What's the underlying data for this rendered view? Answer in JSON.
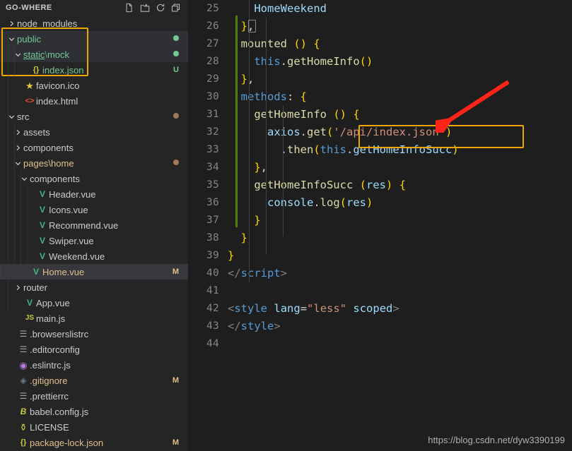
{
  "sidebar": {
    "title": "GO-WHERE",
    "actions": [
      {
        "name": "new-file-icon",
        "tooltip": "New File"
      },
      {
        "name": "new-folder-icon",
        "tooltip": "New Folder"
      },
      {
        "name": "refresh-icon",
        "tooltip": "Refresh Explorer"
      },
      {
        "name": "collapse-all-icon",
        "tooltip": "Collapse Folders in Explorer"
      }
    ],
    "tree": [
      {
        "label": "node_modules",
        "kind": "folder",
        "depth": 0,
        "expanded": false,
        "icon": "chevron-right-icon",
        "badge": "",
        "dot": "",
        "color": "white",
        "state": ""
      },
      {
        "label": "public",
        "kind": "folder",
        "depth": 0,
        "expanded": true,
        "icon": "chevron-down-icon",
        "badge": "",
        "dot": "green",
        "color": "green",
        "state": "sel-bg"
      },
      {
        "label": "static\\mock",
        "kind": "folder",
        "depth": 1,
        "expanded": true,
        "icon": "chevron-down-icon",
        "badge": "",
        "dot": "green",
        "color": "green",
        "state": "sel-bg",
        "underline": "static"
      },
      {
        "label": "index.json",
        "kind": "json",
        "depth": 2,
        "expanded": null,
        "icon": "json-file-icon",
        "badge": "U",
        "badgeClass": "u",
        "dot": "",
        "color": "green",
        "state": ""
      },
      {
        "label": "favicon.ico",
        "kind": "ico",
        "depth": 1,
        "expanded": null,
        "icon": "star-icon",
        "badge": "",
        "dot": "",
        "color": "white",
        "state": ""
      },
      {
        "label": "index.html",
        "kind": "html",
        "depth": 1,
        "expanded": null,
        "icon": "html-file-icon",
        "badge": "",
        "dot": "",
        "color": "white",
        "state": ""
      },
      {
        "label": "src",
        "kind": "folder",
        "depth": 0,
        "expanded": true,
        "icon": "chevron-down-icon",
        "badge": "",
        "dot": "amber",
        "color": "white",
        "state": ""
      },
      {
        "label": "assets",
        "kind": "folder",
        "depth": 1,
        "expanded": false,
        "icon": "chevron-right-icon",
        "badge": "",
        "dot": "",
        "color": "white",
        "state": ""
      },
      {
        "label": "components",
        "kind": "folder",
        "depth": 1,
        "expanded": false,
        "icon": "chevron-right-icon",
        "badge": "",
        "dot": "",
        "color": "white",
        "state": ""
      },
      {
        "label": "pages\\home",
        "kind": "folder",
        "depth": 1,
        "expanded": true,
        "icon": "chevron-down-icon",
        "badge": "",
        "dot": "amber",
        "color": "amber",
        "state": ""
      },
      {
        "label": "components",
        "kind": "folder",
        "depth": 2,
        "expanded": true,
        "icon": "chevron-down-icon",
        "badge": "",
        "dot": "",
        "color": "white",
        "state": ""
      },
      {
        "label": "Header.vue",
        "kind": "vue",
        "depth": 3,
        "expanded": null,
        "icon": "vue-file-icon",
        "badge": "",
        "dot": "",
        "color": "white",
        "state": ""
      },
      {
        "label": "Icons.vue",
        "kind": "vue",
        "depth": 3,
        "expanded": null,
        "icon": "vue-file-icon",
        "badge": "",
        "dot": "",
        "color": "white",
        "state": ""
      },
      {
        "label": "Recommend.vue",
        "kind": "vue",
        "depth": 3,
        "expanded": null,
        "icon": "vue-file-icon",
        "badge": "",
        "dot": "",
        "color": "white",
        "state": ""
      },
      {
        "label": "Swiper.vue",
        "kind": "vue",
        "depth": 3,
        "expanded": null,
        "icon": "vue-file-icon",
        "badge": "",
        "dot": "",
        "color": "white",
        "state": ""
      },
      {
        "label": "Weekend.vue",
        "kind": "vue",
        "depth": 3,
        "expanded": null,
        "icon": "vue-file-icon",
        "badge": "",
        "dot": "",
        "color": "white",
        "state": ""
      },
      {
        "label": "Home.vue",
        "kind": "vue",
        "depth": 2,
        "expanded": null,
        "icon": "vue-file-icon",
        "badge": "M",
        "badgeClass": "m",
        "dot": "",
        "color": "amber",
        "state": "active"
      },
      {
        "label": "router",
        "kind": "folder",
        "depth": 1,
        "expanded": false,
        "icon": "chevron-right-icon",
        "badge": "",
        "dot": "",
        "color": "white",
        "state": ""
      },
      {
        "label": "App.vue",
        "kind": "vue",
        "depth": 1,
        "expanded": null,
        "icon": "vue-file-icon",
        "badge": "",
        "dot": "",
        "color": "white",
        "state": ""
      },
      {
        "label": "main.js",
        "kind": "js",
        "depth": 1,
        "expanded": null,
        "icon": "js-file-icon",
        "badge": "",
        "dot": "",
        "color": "white",
        "state": ""
      },
      {
        "label": ".browserslistrc",
        "kind": "cfg",
        "depth": 0,
        "expanded": null,
        "icon": "config-lines-icon",
        "badge": "",
        "dot": "",
        "color": "white",
        "state": ""
      },
      {
        "label": ".editorconfig",
        "kind": "cfg",
        "depth": 0,
        "expanded": null,
        "icon": "gear-icon",
        "badge": "",
        "dot": "",
        "color": "white",
        "state": ""
      },
      {
        "label": ".eslintrc.js",
        "kind": "eslint",
        "depth": 0,
        "expanded": null,
        "icon": "eslint-icon",
        "badge": "",
        "dot": "",
        "color": "white",
        "state": ""
      },
      {
        "label": ".gitignore",
        "kind": "git",
        "depth": 0,
        "expanded": null,
        "icon": "git-icon",
        "badge": "M",
        "badgeClass": "m",
        "dot": "",
        "color": "amber",
        "state": ""
      },
      {
        "label": ".prettierrc",
        "kind": "cfg",
        "depth": 0,
        "expanded": null,
        "icon": "config-lines-icon",
        "badge": "",
        "dot": "",
        "color": "white",
        "state": ""
      },
      {
        "label": "babel.config.js",
        "kind": "babel",
        "depth": 0,
        "expanded": null,
        "icon": "babel-icon",
        "badge": "",
        "dot": "",
        "color": "white",
        "state": ""
      },
      {
        "label": "LICENSE",
        "kind": "license",
        "depth": 0,
        "expanded": null,
        "icon": "license-icon",
        "badge": "",
        "dot": "",
        "color": "white",
        "state": ""
      },
      {
        "label": "package-lock.json",
        "kind": "json",
        "depth": 0,
        "expanded": null,
        "icon": "json-file-icon",
        "badge": "M",
        "badgeClass": "m",
        "dot": "",
        "color": "amber",
        "state": ""
      }
    ]
  },
  "editor": {
    "first_line_number": 25,
    "lines": [
      {
        "n": 25,
        "tokens": [
          {
            "t": "    ",
            "c": "plain"
          },
          {
            "t": "HomeWeekend",
            "c": "lblue"
          }
        ]
      },
      {
        "n": 26,
        "tokens": [
          {
            "t": "  ",
            "c": "plain"
          },
          {
            "t": "}",
            "c": "gold"
          },
          {
            "t": ",",
            "c": "plain"
          }
        ]
      },
      {
        "n": 27,
        "tokens": [
          {
            "t": "  ",
            "c": "plain"
          },
          {
            "t": "mounted",
            "c": "yellow"
          },
          {
            "t": " ",
            "c": "plain"
          },
          {
            "t": "()",
            "c": "gold"
          },
          {
            "t": " ",
            "c": "plain"
          },
          {
            "t": "{",
            "c": "gold"
          }
        ]
      },
      {
        "n": 28,
        "tokens": [
          {
            "t": "    ",
            "c": "plain"
          },
          {
            "t": "this",
            "c": "blue"
          },
          {
            "t": ".",
            "c": "plain"
          },
          {
            "t": "getHomeInfo",
            "c": "yellow"
          },
          {
            "t": "()",
            "c": "gold"
          }
        ]
      },
      {
        "n": 29,
        "tokens": [
          {
            "t": "  ",
            "c": "plain"
          },
          {
            "t": "}",
            "c": "gold"
          },
          {
            "t": ",",
            "c": "plain"
          }
        ]
      },
      {
        "n": 30,
        "tokens": [
          {
            "t": "  ",
            "c": "plain"
          },
          {
            "t": "methods",
            "c": "blue"
          },
          {
            "t": ": ",
            "c": "plain"
          },
          {
            "t": "{",
            "c": "gold"
          }
        ]
      },
      {
        "n": 31,
        "tokens": [
          {
            "t": "    ",
            "c": "plain"
          },
          {
            "t": "getHomeInfo",
            "c": "yellow"
          },
          {
            "t": " ",
            "c": "plain"
          },
          {
            "t": "()",
            "c": "gold"
          },
          {
            "t": " ",
            "c": "plain"
          },
          {
            "t": "{",
            "c": "gold"
          }
        ]
      },
      {
        "n": 32,
        "tokens": [
          {
            "t": "      ",
            "c": "plain"
          },
          {
            "t": "axios",
            "c": "lblue"
          },
          {
            "t": ".",
            "c": "plain"
          },
          {
            "t": "get",
            "c": "yellow"
          },
          {
            "t": "(",
            "c": "gold"
          },
          {
            "t": "'/api/index.json'",
            "c": "orange"
          },
          {
            "t": ")",
            "c": "gold"
          }
        ]
      },
      {
        "n": 33,
        "tokens": [
          {
            "t": "        ",
            "c": "plain"
          },
          {
            "t": ".",
            "c": "plain"
          },
          {
            "t": "then",
            "c": "yellow"
          },
          {
            "t": "(",
            "c": "gold"
          },
          {
            "t": "this",
            "c": "blue"
          },
          {
            "t": ".",
            "c": "plain"
          },
          {
            "t": "getHomeInfoSucc",
            "c": "lblue"
          },
          {
            "t": ")",
            "c": "gold"
          }
        ]
      },
      {
        "n": 34,
        "tokens": [
          {
            "t": "    ",
            "c": "plain"
          },
          {
            "t": "}",
            "c": "gold"
          },
          {
            "t": ",",
            "c": "plain"
          }
        ]
      },
      {
        "n": 35,
        "tokens": [
          {
            "t": "    ",
            "c": "plain"
          },
          {
            "t": "getHomeInfoSucc",
            "c": "yellow"
          },
          {
            "t": " ",
            "c": "plain"
          },
          {
            "t": "(",
            "c": "gold"
          },
          {
            "t": "res",
            "c": "lblue"
          },
          {
            "t": ")",
            "c": "gold"
          },
          {
            "t": " ",
            "c": "plain"
          },
          {
            "t": "{",
            "c": "gold"
          }
        ]
      },
      {
        "n": 36,
        "tokens": [
          {
            "t": "      ",
            "c": "plain"
          },
          {
            "t": "console",
            "c": "lblue"
          },
          {
            "t": ".",
            "c": "plain"
          },
          {
            "t": "log",
            "c": "yellow"
          },
          {
            "t": "(",
            "c": "gold"
          },
          {
            "t": "res",
            "c": "lblue"
          },
          {
            "t": ")",
            "c": "gold"
          }
        ]
      },
      {
        "n": 37,
        "tokens": [
          {
            "t": "    ",
            "c": "plain"
          },
          {
            "t": "}",
            "c": "gold"
          }
        ]
      },
      {
        "n": 38,
        "tokens": [
          {
            "t": "  ",
            "c": "plain"
          },
          {
            "t": "}",
            "c": "gold"
          }
        ]
      },
      {
        "n": 39,
        "tokens": [
          {
            "t": "}",
            "c": "gold"
          }
        ]
      },
      {
        "n": 40,
        "tokens": [
          {
            "t": "</",
            "c": "tag"
          },
          {
            "t": "script",
            "c": "blue"
          },
          {
            "t": ">",
            "c": "tag"
          }
        ]
      },
      {
        "n": 41,
        "tokens": []
      },
      {
        "n": 42,
        "tokens": [
          {
            "t": "<",
            "c": "tag"
          },
          {
            "t": "style",
            "c": "blue"
          },
          {
            "t": " ",
            "c": "plain"
          },
          {
            "t": "lang",
            "c": "lblue"
          },
          {
            "t": "=",
            "c": "plain"
          },
          {
            "t": "\"less\"",
            "c": "orange"
          },
          {
            "t": " ",
            "c": "plain"
          },
          {
            "t": "scoped",
            "c": "lblue"
          },
          {
            "t": ">",
            "c": "tag"
          }
        ]
      },
      {
        "n": 43,
        "tokens": [
          {
            "t": "</",
            "c": "tag"
          },
          {
            "t": "style",
            "c": "blue"
          },
          {
            "t": ">",
            "c": "tag"
          }
        ]
      },
      {
        "n": 44,
        "tokens": []
      }
    ]
  },
  "annotations": {
    "highlight_box_sidebar": {
      "label": "public / static-mock / index.json highlight",
      "color": "#f0a500"
    },
    "highlight_box_code": {
      "label": "axios get url highlight",
      "color": "#f0a500"
    },
    "arrow": {
      "label": "red pointer arrow",
      "color": "#ff2318"
    },
    "watermark": "https://blog.csdn.net/dyw3390199"
  }
}
